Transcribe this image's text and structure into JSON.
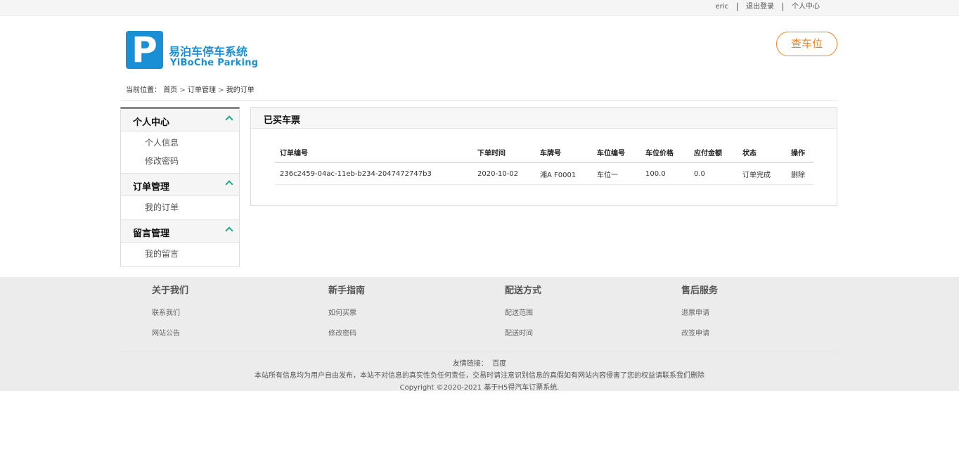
{
  "topbar": {
    "user": "eric",
    "logout": "退出登录",
    "personal_center": "个人中心"
  },
  "header": {
    "logo_letter": "P",
    "brand_cn": "易泊车停车系统",
    "brand_en": "YiBoChe  Parking",
    "check_button": "查车位",
    "accent_color": "#1a8fd6",
    "button_color": "#f0861a"
  },
  "breadcrumb": {
    "label": "当前位置：",
    "items": [
      "首页",
      "订单管理",
      "我的订单"
    ],
    "separator": ">"
  },
  "sidebar": {
    "groups": [
      {
        "title": "个人中心",
        "items": [
          "个人信息",
          "修改密码"
        ]
      },
      {
        "title": "订单管理",
        "items": [
          "我的订单"
        ]
      },
      {
        "title": "留言管理",
        "items": [
          "我的留言"
        ]
      }
    ]
  },
  "main": {
    "title": "已买车票",
    "columns": [
      "订单编号",
      "下单时间",
      "车牌号",
      "车位编号",
      "车位价格",
      "应付金额",
      "状态",
      "操作"
    ],
    "rows": [
      {
        "order_no": "236c2459-04ac-11eb-b234-2047472747b3",
        "time": "2020-10-02",
        "plate": "湘A F0001",
        "slot": "车位一",
        "price": "100.0",
        "payable": "0.0",
        "status": "订单完成",
        "action": "删除"
      }
    ]
  },
  "footer": {
    "columns": [
      {
        "title": "关于我们",
        "links": [
          "联系我们",
          "网站公告"
        ]
      },
      {
        "title": "新手指南",
        "links": [
          "如何买票",
          "修改密码"
        ]
      },
      {
        "title": "配送方式",
        "links": [
          "配送范围",
          "配送时间"
        ]
      },
      {
        "title": "售后服务",
        "links": [
          "退票申请",
          "改签申请"
        ]
      }
    ],
    "friend_label": "友情链接：",
    "friend_link": "百度",
    "notice": "本站所有信息均为用户自由发布，本站不对信息的真实性负任何责任，交易时请注意识别信息的真假如有网站内容侵害了您的权益请联系我们删除",
    "copyright": "Copyright ©2020-2021 基于H5得汽车订票系统."
  }
}
